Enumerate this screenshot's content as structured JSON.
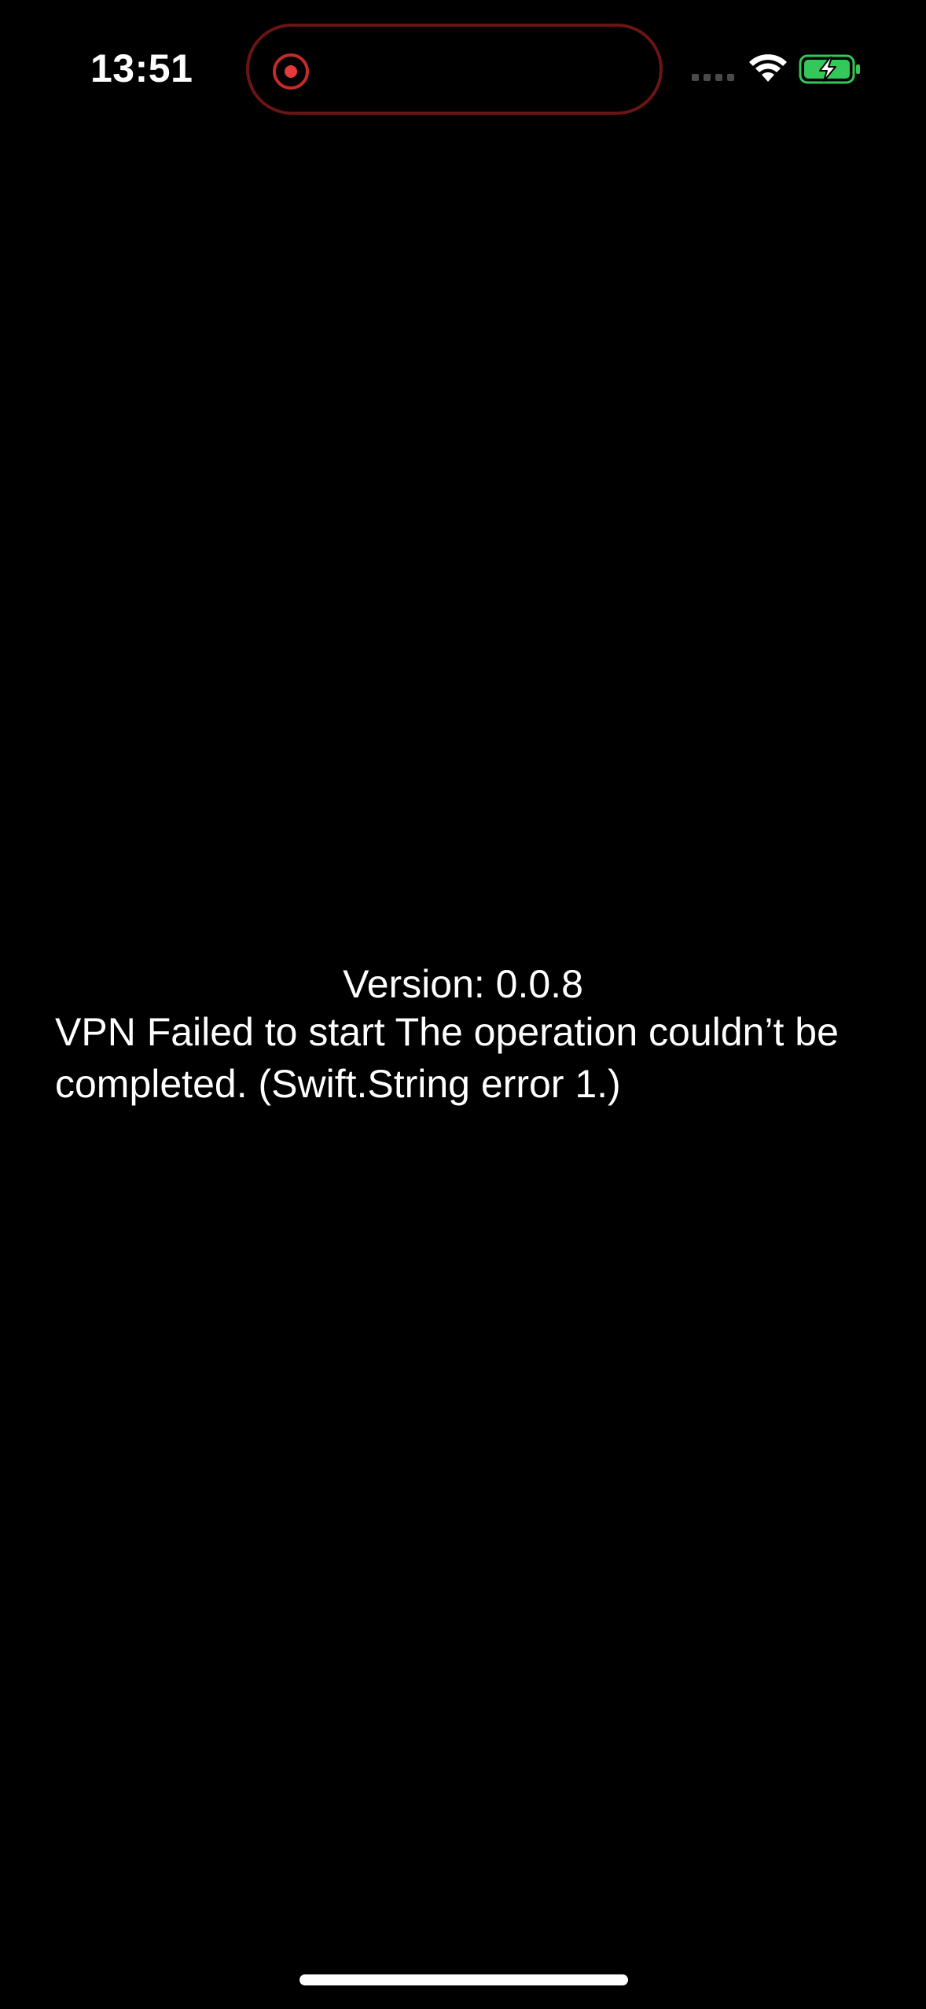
{
  "status_bar": {
    "time": "13:51",
    "recording_color": "#e8393a",
    "island_border_color": "#6b1414",
    "battery_fill_color": "#34c759",
    "icons": [
      "record-indicator-icon",
      "cellular-signal-icon",
      "wifi-icon",
      "battery-charging-icon"
    ]
  },
  "main": {
    "version": "Version: 0.0.8",
    "error": "VPN Failed to start The operation couldn’t be completed. (Swift.String error 1.)"
  }
}
